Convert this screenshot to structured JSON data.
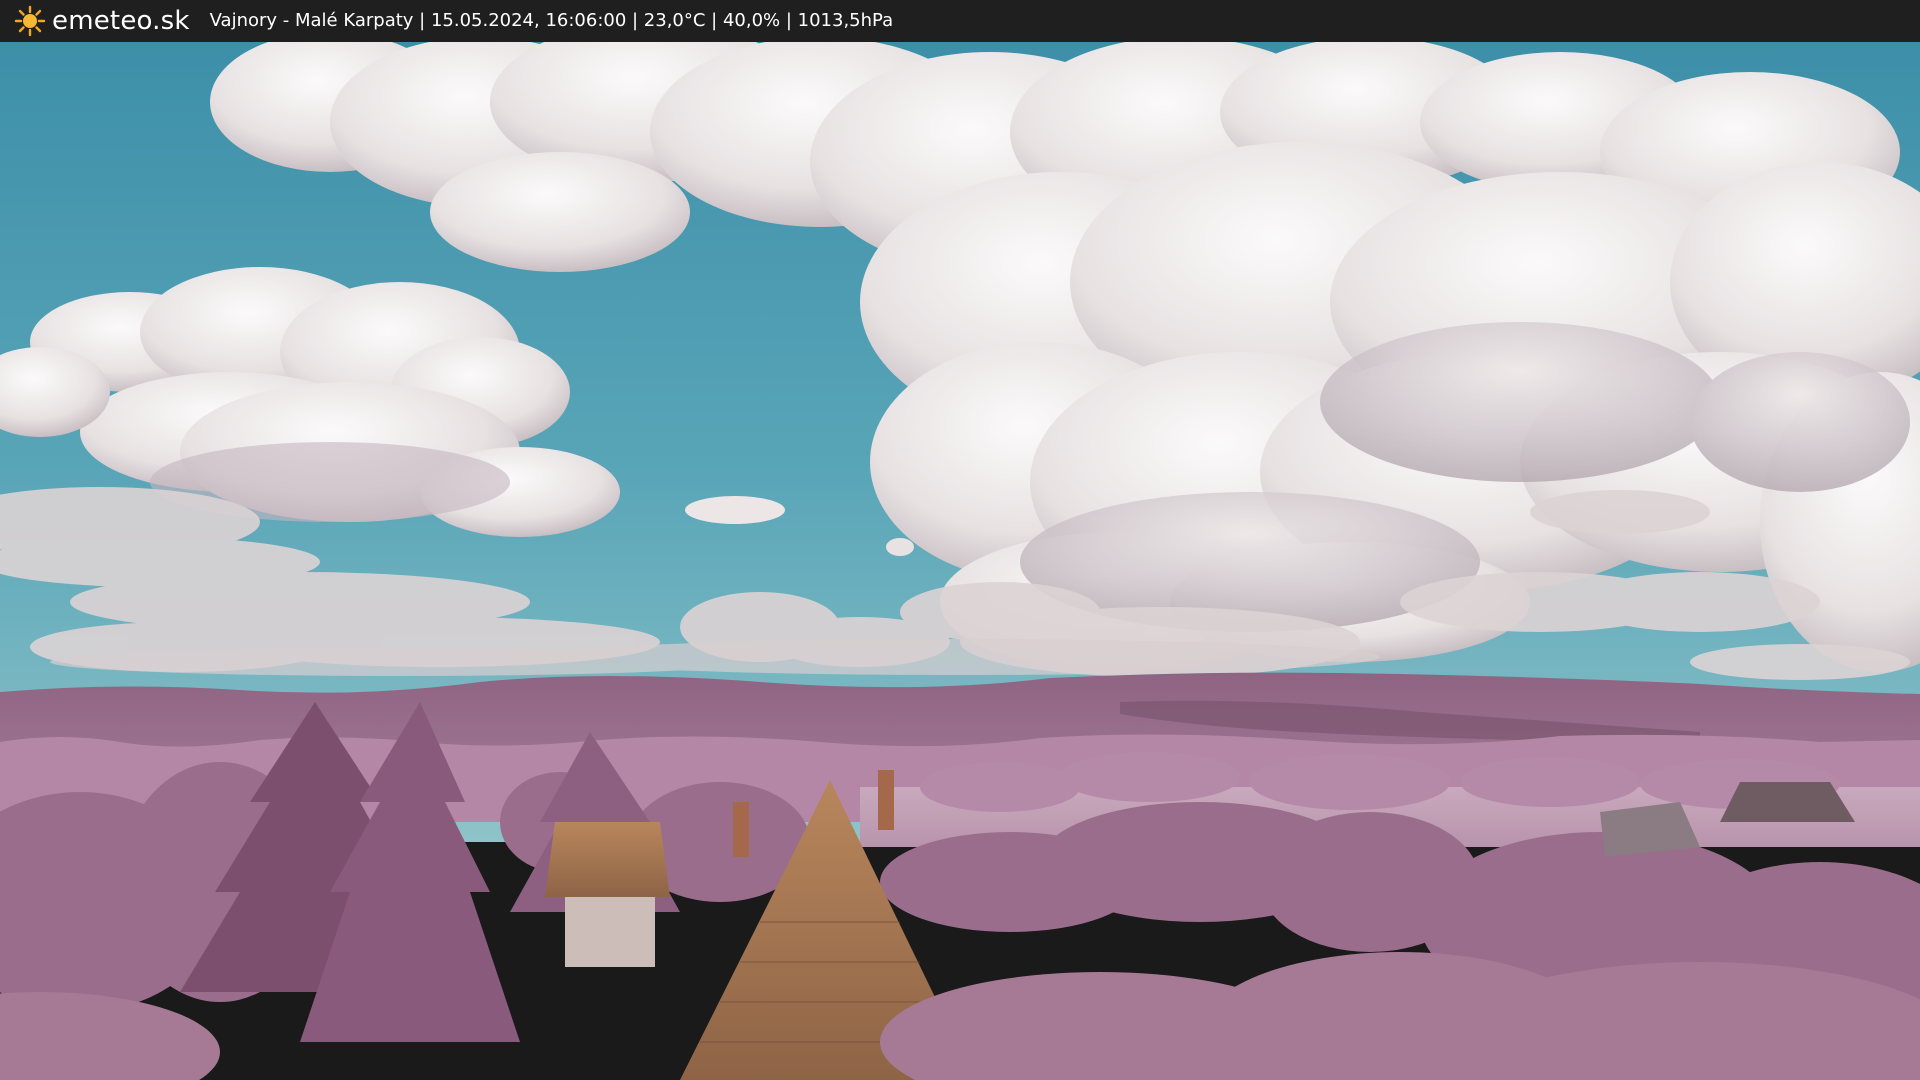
{
  "header": {
    "site_name": "emeteo.sk",
    "logo_icon": "sun-icon",
    "caption": "Vajnory - Malé Karpaty | 15.05.2024, 16:06:00 | 23,0°C | 40,0% | 1013,5hPa"
  },
  "colors": {
    "bar_background": "#1f1f1f",
    "sun": "#f5a623",
    "sky_top": "#3f90a8",
    "sky_bottom": "#78b8c6",
    "foliage": "#a07090",
    "roof": "#b07a52"
  }
}
